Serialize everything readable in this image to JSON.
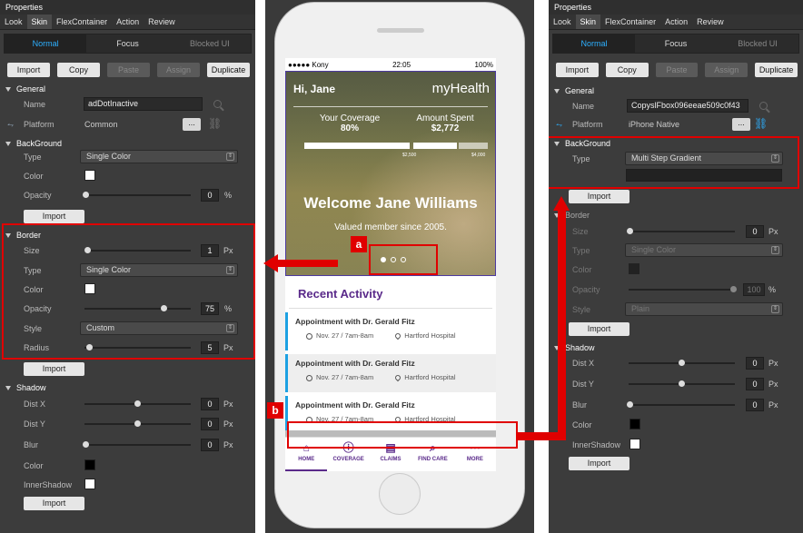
{
  "left_panel": {
    "title": "Properties",
    "tabs": [
      "Look",
      "Skin",
      "FlexContainer",
      "Action",
      "Review"
    ],
    "active_tab": "Skin",
    "states": [
      "Normal",
      "Focus",
      "Blocked UI"
    ],
    "buttons": [
      "Import",
      "Copy",
      "Paste",
      "Assign",
      "Duplicate"
    ],
    "general": {
      "header": "General",
      "name_label": "Name",
      "name_value": "adDotInactive",
      "platform_label": "Platform",
      "platform_value": "Common",
      "dots": "..."
    },
    "background": {
      "header": "BackGround",
      "type_label": "Type",
      "type_value": "Single Color",
      "color_label": "Color",
      "color": "#ffffff",
      "opacity_label": "Opacity",
      "opacity_value": "0",
      "opacity_unit": "%",
      "import": "Import"
    },
    "border": {
      "header": "Border",
      "size_label": "Size",
      "size_value": "1",
      "size_unit": "Px",
      "type_label": "Type",
      "type_value": "Single Color",
      "color_label": "Color",
      "color": "#ffffff",
      "opacity_label": "Opacity",
      "opacity_value": "75",
      "opacity_unit": "%",
      "style_label": "Style",
      "style_value": "Custom",
      "radius_label": "Radius",
      "radius_value": "5",
      "radius_unit": "Px",
      "import": "Import"
    },
    "shadow": {
      "header": "Shadow",
      "distx_label": "Dist X",
      "distx_value": "0",
      "disty_label": "Dist Y",
      "disty_value": "0",
      "blur_label": "Blur",
      "blur_value": "0",
      "unit": "Px",
      "color_label": "Color",
      "color": "#000000",
      "inner_label": "InnerShadow",
      "inner_color": "#ffffff",
      "import": "Import"
    }
  },
  "right_panel": {
    "title": "Properties",
    "tabs": [
      "Look",
      "Skin",
      "FlexContainer",
      "Action",
      "Review"
    ],
    "active_tab": "Skin",
    "states": [
      "Normal",
      "Focus",
      "Blocked UI"
    ],
    "buttons": [
      "Import",
      "Copy",
      "Paste",
      "Assign",
      "Duplicate"
    ],
    "general": {
      "header": "General",
      "name_label": "Name",
      "name_value": "CopyslFbox096eeae509c0f43",
      "platform_label": "Platform",
      "platform_value": "iPhone Native",
      "dots": "..."
    },
    "background": {
      "header": "BackGround",
      "type_label": "Type",
      "type_value": "Multi Step Gradient",
      "import": "Import"
    },
    "border": {
      "header": "Border",
      "size_label": "Size",
      "size_value": "0",
      "size_unit": "Px",
      "type_label": "Type",
      "type_value": "Single Color",
      "color_label": "Color",
      "opacity_label": "Opacity",
      "opacity_value": "100",
      "opacity_unit": "%",
      "style_label": "Style",
      "style_value": "Plain",
      "import": "Import"
    },
    "shadow": {
      "header": "Shadow",
      "distx_label": "Dist X",
      "distx_value": "0",
      "disty_label": "Dist Y",
      "disty_value": "0",
      "blur_label": "Blur",
      "blur_value": "0",
      "unit": "Px",
      "color_label": "Color",
      "color": "#000000",
      "inner_label": "InnerShadow",
      "inner_color": "#ffffff",
      "import": "Import"
    }
  },
  "phone": {
    "status": {
      "carrier": "●●●●● Kony",
      "time": "22:05",
      "battery": "100%"
    },
    "greeting": "Hi, Jane",
    "brand": "myHealth",
    "coverage_label": "Your Coverage",
    "coverage_value": "80%",
    "spent_label": "Amount Spent",
    "spent_value": "$2,772",
    "tick1": "$2,500",
    "tick2": "$4,000",
    "welcome": "Welcome Jane Williams",
    "member_since": "Valued member since 2005.",
    "activity_title": "Recent Activity",
    "appointments": [
      {
        "title": "Appointment with Dr. Gerald Fitz",
        "when": "Nov. 27 / 7am-8am",
        "where": "Hartford Hospital"
      },
      {
        "title": "Appointment with Dr. Gerald Fitz",
        "when": "Nov. 27 / 7am-8am",
        "where": "Hartford Hospital"
      },
      {
        "title": "Appointment with Dr. Gerald Fitz",
        "when": "Nov. 27 / 7am-8am",
        "where": "Hartford Hospital"
      }
    ],
    "tabbar": [
      "HOME",
      "COVERAGE",
      "CLAIMS",
      "FIND CARE",
      "MORE"
    ]
  },
  "callouts": {
    "a": "a",
    "b": "b"
  }
}
